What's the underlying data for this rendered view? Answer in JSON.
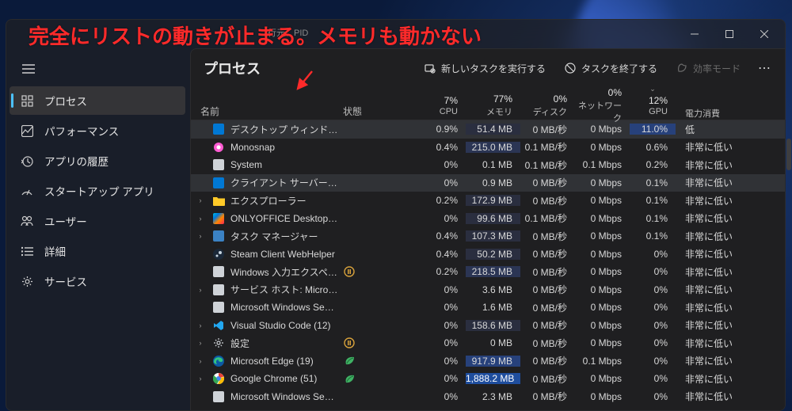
{
  "overlay": "完全にリストの動きが止まる。メモリも動かない",
  "hidden_titlebar": "行元、PID",
  "sidebar": {
    "items": [
      {
        "label": "プロセス"
      },
      {
        "label": "パフォーマンス"
      },
      {
        "label": "アプリの履歴"
      },
      {
        "label": "スタートアップ アプリ"
      },
      {
        "label": "ユーザー"
      },
      {
        "label": "詳細"
      },
      {
        "label": "サービス"
      }
    ]
  },
  "toolbar": {
    "title": "プロセス",
    "new_task": "新しいタスクを実行する",
    "end_task": "タスクを終了する",
    "efficiency": "効率モード"
  },
  "columns": {
    "name": "名前",
    "status": "状態",
    "cpu": {
      "pct": "7%",
      "label": "CPU"
    },
    "mem": {
      "pct": "77%",
      "label": "メモリ"
    },
    "disk": {
      "pct": "0%",
      "label": "ディスク"
    },
    "net": {
      "pct": "0%",
      "label": "ネットワーク"
    },
    "gpu": {
      "pct": "12%",
      "label": "GPU"
    },
    "power": {
      "label": "電力消費"
    }
  },
  "rows": [
    {
      "exp": "",
      "icon": "win",
      "name": "デスクトップ ウィンドウ マネージャー",
      "cpu": "0.9%",
      "mem": "51.4 MB",
      "disk": "0 MB/秒",
      "net": "0 Mbps",
      "gpu": "11.0%",
      "pow": "低",
      "heat": {
        "gpu": 3,
        "mem": 1
      },
      "sel": true
    },
    {
      "exp": "",
      "icon": "mono",
      "name": "Monosnap",
      "cpu": "0.4%",
      "mem": "215.0 MB",
      "disk": "0.1 MB/秒",
      "net": "0 Mbps",
      "gpu": "0.6%",
      "pow": "非常に低い",
      "heat": {
        "mem": 2
      }
    },
    {
      "exp": "",
      "icon": "sys",
      "name": "System",
      "cpu": "0%",
      "mem": "0.1 MB",
      "disk": "0.1 MB/秒",
      "net": "0.1 Mbps",
      "gpu": "0.2%",
      "pow": "非常に低い"
    },
    {
      "exp": "",
      "icon": "win",
      "name": "クライアント サーバー ランタイム プロ…",
      "cpu": "0%",
      "mem": "0.9 MB",
      "disk": "0 MB/秒",
      "net": "0 Mbps",
      "gpu": "0.1%",
      "pow": "非常に低い",
      "sel2": true
    },
    {
      "exp": ">",
      "icon": "folder",
      "name": "エクスプローラー",
      "cpu": "0.2%",
      "mem": "172.9 MB",
      "disk": "0 MB/秒",
      "net": "0 Mbps",
      "gpu": "0.1%",
      "pow": "非常に低い",
      "heat": {
        "mem": 1
      }
    },
    {
      "exp": ">",
      "icon": "oo",
      "name": "ONLYOFFICE Desktop Editors (…",
      "cpu": "0%",
      "mem": "99.6 MB",
      "disk": "0.1 MB/秒",
      "net": "0 Mbps",
      "gpu": "0.1%",
      "pow": "非常に低い",
      "heat": {
        "mem": 1
      }
    },
    {
      "exp": ">",
      "icon": "tm",
      "name": "タスク マネージャー",
      "cpu": "0.4%",
      "mem": "107.3 MB",
      "disk": "0 MB/秒",
      "net": "0 Mbps",
      "gpu": "0.1%",
      "pow": "非常に低い",
      "heat": {
        "mem": 1
      }
    },
    {
      "exp": "",
      "icon": "steam",
      "name": "Steam Client WebHelper",
      "cpu": "0.4%",
      "mem": "50.2 MB",
      "disk": "0 MB/秒",
      "net": "0 Mbps",
      "gpu": "0%",
      "pow": "非常に低い",
      "heat": {
        "mem": 1
      }
    },
    {
      "exp": "",
      "icon": "ime",
      "name": "Windows 入力エクスペリエンス",
      "badge": "pause",
      "cpu": "0.2%",
      "mem": "218.5 MB",
      "disk": "0 MB/秒",
      "net": "0 Mbps",
      "gpu": "0%",
      "pow": "非常に低い",
      "heat": {
        "mem": 2
      }
    },
    {
      "exp": ">",
      "icon": "svc",
      "name": "サービス ホスト: Microsoft Accou…",
      "cpu": "0%",
      "mem": "3.6 MB",
      "disk": "0 MB/秒",
      "net": "0 Mbps",
      "gpu": "0%",
      "pow": "非常に低い"
    },
    {
      "exp": "",
      "icon": "search",
      "name": "Microsoft Windows Search Filt…",
      "cpu": "0%",
      "mem": "1.6 MB",
      "disk": "0 MB/秒",
      "net": "0 Mbps",
      "gpu": "0%",
      "pow": "非常に低い"
    },
    {
      "exp": ">",
      "icon": "vsc",
      "name": "Visual Studio Code (12)",
      "cpu": "0%",
      "mem": "158.6 MB",
      "disk": "0 MB/秒",
      "net": "0 Mbps",
      "gpu": "0%",
      "pow": "非常に低い",
      "heat": {
        "mem": 1
      }
    },
    {
      "exp": ">",
      "icon": "gear",
      "name": "設定",
      "badge": "pause",
      "cpu": "0%",
      "mem": "0 MB",
      "disk": "0 MB/秒",
      "net": "0 Mbps",
      "gpu": "0%",
      "pow": "非常に低い"
    },
    {
      "exp": ">",
      "icon": "edge",
      "name": "Microsoft Edge (19)",
      "badge": "leaf",
      "cpu": "0%",
      "mem": "917.9 MB",
      "disk": "0 MB/秒",
      "net": "0.1 Mbps",
      "gpu": "0%",
      "pow": "非常に低い",
      "heat": {
        "mem": 3
      }
    },
    {
      "exp": ">",
      "icon": "chrome",
      "name": "Google Chrome (51)",
      "badge": "leaf",
      "cpu": "0%",
      "mem": "1,888.2 MB",
      "disk": "0 MB/秒",
      "net": "0 Mbps",
      "gpu": "0%",
      "pow": "非常に低い",
      "heat": {
        "mem": 4
      }
    },
    {
      "exp": "",
      "icon": "search",
      "name": "Microsoft Windows Search P…",
      "cpu": "0%",
      "mem": "2.3 MB",
      "disk": "0 MB/秒",
      "net": "0 Mbps",
      "gpu": "0%",
      "pow": "非常に低い"
    }
  ]
}
